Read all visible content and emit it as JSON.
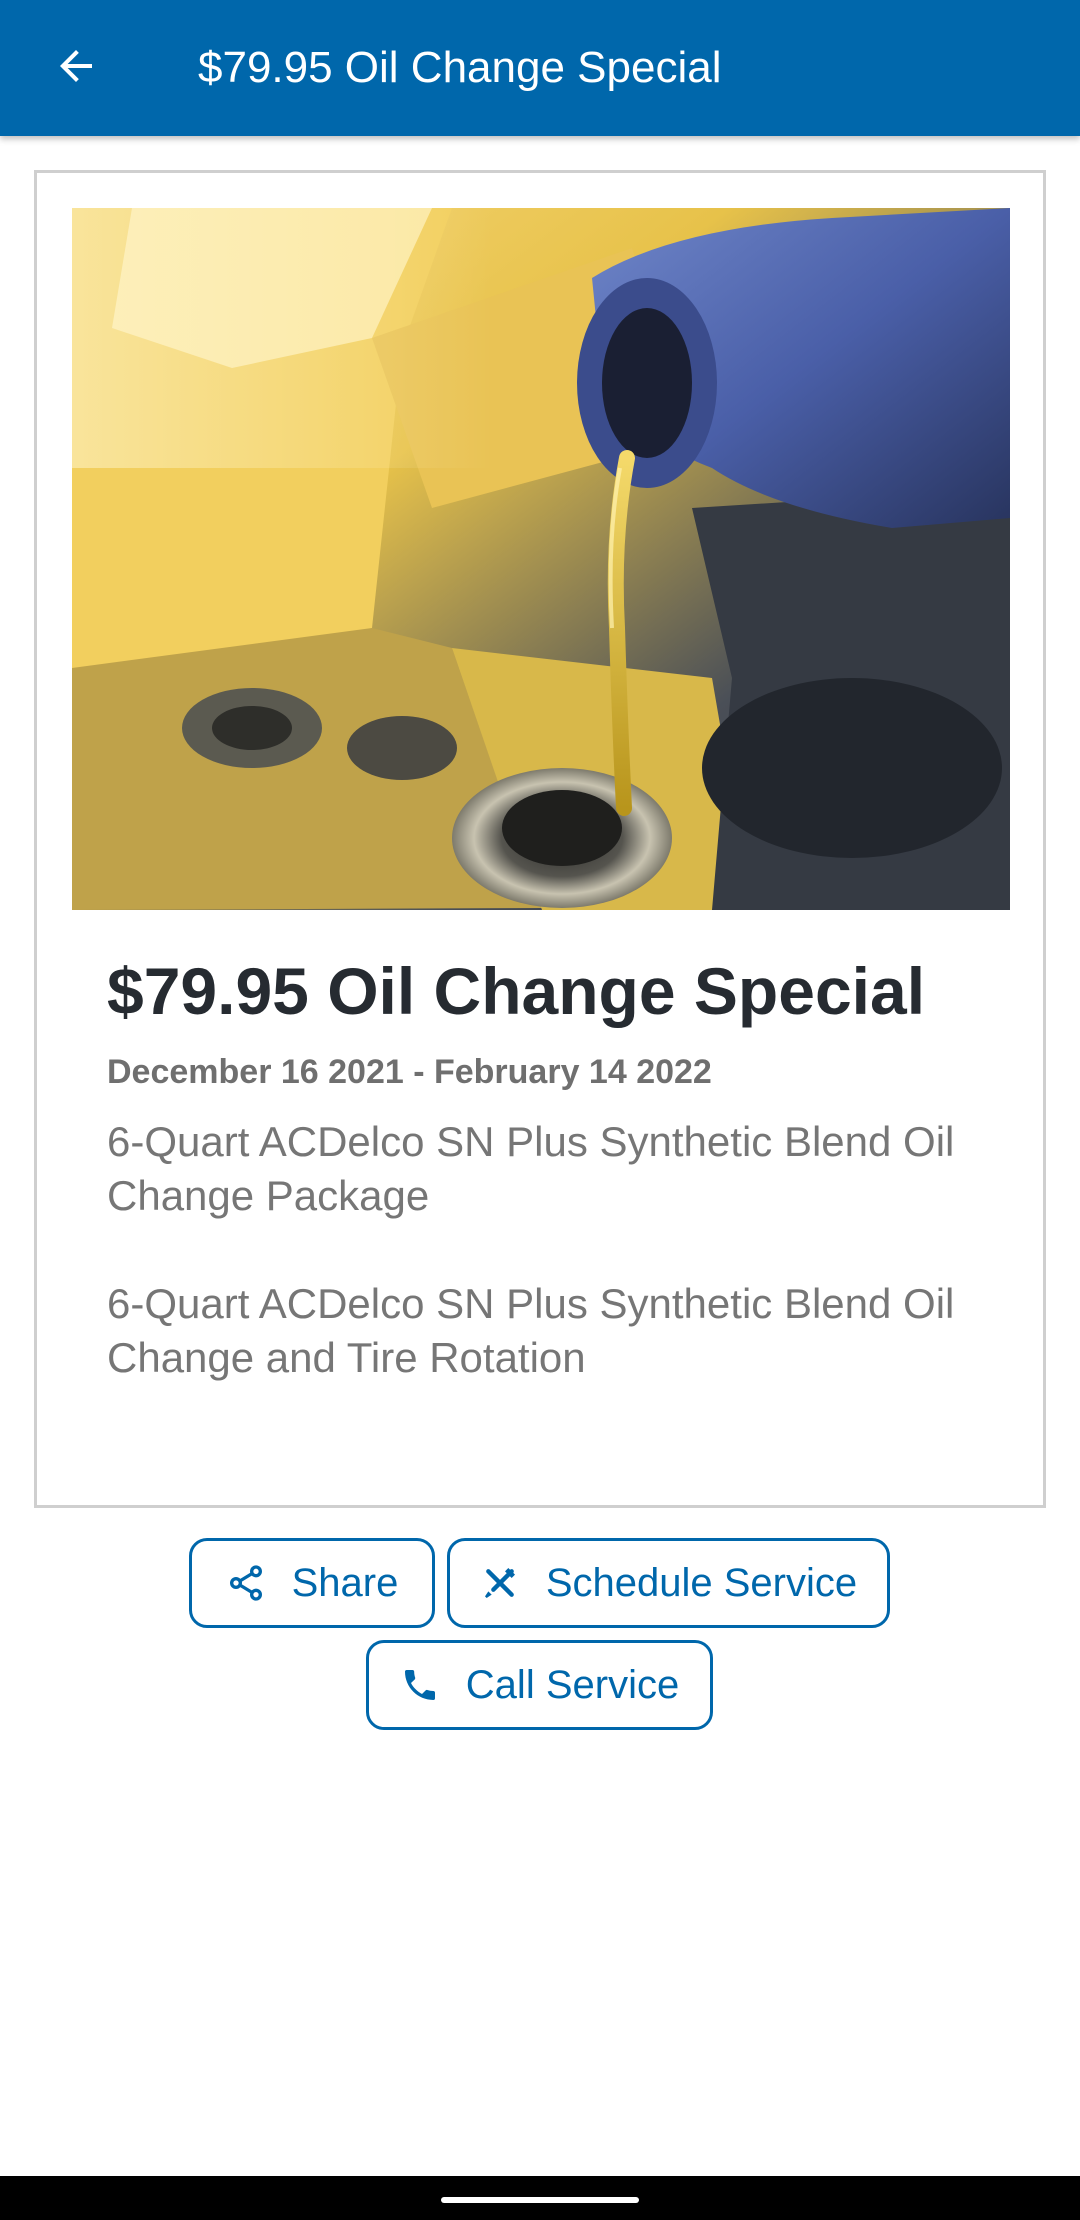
{
  "app_bar": {
    "title": "$79.95 Oil Change Special",
    "back_icon": "arrow-back-icon",
    "color": "#0067ab"
  },
  "promo": {
    "image_alt": "Motor oil pouring into engine",
    "title": "$79.95 Oil Change Special",
    "dates": "December 16 2021 - February 14 2022",
    "descriptions": [
      "6-Quart ACDelco SN Plus Synthetic Blend Oil Change Package",
      "6-Quart ACDelco SN Plus Synthetic Blend Oil Change and Tire Rotation"
    ]
  },
  "actions": {
    "share": {
      "label": "Share",
      "icon": "share-icon"
    },
    "schedule": {
      "label": "Schedule Service",
      "icon": "tools-icon"
    },
    "call": {
      "label": "Call Service",
      "icon": "phone-icon"
    }
  },
  "colors": {
    "accent": "#0067ab",
    "title_text": "#262b31",
    "muted_text": "#767676"
  }
}
